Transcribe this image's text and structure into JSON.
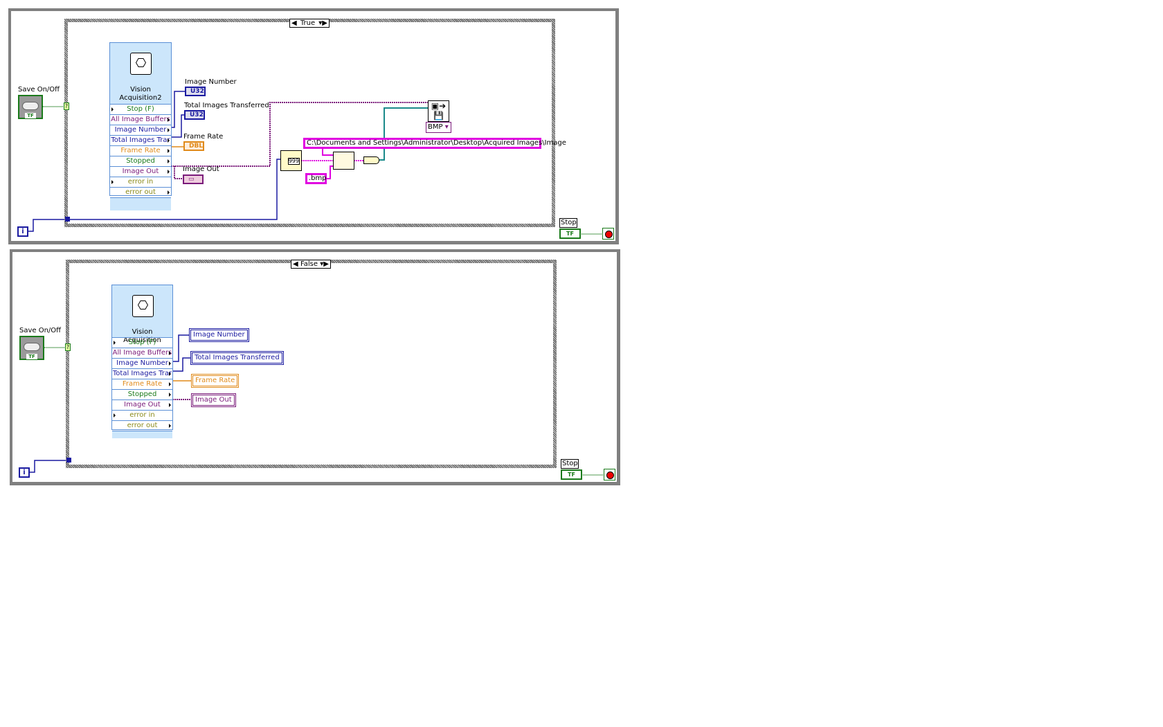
{
  "panels": [
    {
      "case_value": "True",
      "node_title": "Vision Acquisition2",
      "rows": [
        {
          "label": "Stop (F)",
          "color": "#1a7a1a"
        },
        {
          "label": "All Image Buffers",
          "color": "#7a1a7a"
        },
        {
          "label": "Image Number",
          "color": "#1a1aa0"
        },
        {
          "label": "Total Images Trar",
          "color": "#1a1aa0"
        },
        {
          "label": "Frame Rate",
          "color": "#e08a1a"
        },
        {
          "label": "Stopped",
          "color": "#1a7a1a"
        },
        {
          "label": "Image Out",
          "color": "#7a1a7a"
        },
        {
          "label": "error in",
          "color": "#8a8a1a"
        },
        {
          "label": "error out",
          "color": "#8a8a1a"
        }
      ],
      "save_label": "Save On/Off",
      "bool_tf": "TF",
      "tunnel": "?",
      "iteration": "i",
      "stop_label": "Stop",
      "indicators": [
        {
          "label": "Image Number",
          "type": "U32"
        },
        {
          "label": "Total Images Transferred",
          "type": "U32"
        },
        {
          "label": "Frame Rate",
          "type": "DBL"
        },
        {
          "label": "Image Out",
          "type": "▭"
        }
      ],
      "path_constant": "C:\\Documents and Settings\\Administrator\\Desktop\\Acquired Images\\Image",
      "ext_constant": ".bmp",
      "format_display": "999",
      "file_type": "BMP"
    },
    {
      "case_value": "False",
      "node_title": "Vision Acquisition",
      "rows": [
        {
          "label": "Stop (F)",
          "color": "#1a7a1a"
        },
        {
          "label": "All Image Buffers",
          "color": "#7a1a7a"
        },
        {
          "label": "Image Number",
          "color": "#1a1aa0"
        },
        {
          "label": "Total Images Trar",
          "color": "#1a1aa0"
        },
        {
          "label": "Frame Rate",
          "color": "#e08a1a"
        },
        {
          "label": "Stopped",
          "color": "#1a7a1a"
        },
        {
          "label": "Image Out",
          "color": "#7a1a7a"
        },
        {
          "label": "error in",
          "color": "#8a8a1a"
        },
        {
          "label": "error out",
          "color": "#8a8a1a"
        }
      ],
      "save_label": "Save On/Off",
      "bool_tf": "TF",
      "tunnel": "?",
      "iteration": "i",
      "stop_label": "Stop",
      "indicators": [
        {
          "label": "Image Number"
        },
        {
          "label": "Total Images Transferred"
        },
        {
          "label": "Frame Rate"
        },
        {
          "label": "Image Out"
        }
      ]
    }
  ],
  "colors": {
    "int_wire": "#1a1aa0",
    "string_wire": "#e000e0",
    "image_wire": "#7a1a7a",
    "dbl_wire": "#e08a1a",
    "path_wire": "#1a8a8a",
    "bool_wire": "#1a7a1a"
  }
}
